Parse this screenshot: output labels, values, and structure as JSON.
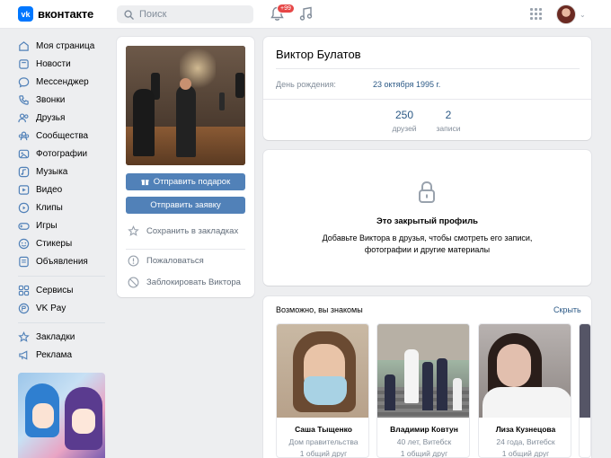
{
  "header": {
    "logo_letters": "vk",
    "logo_text": "вконтакте",
    "search_placeholder": "Поиск",
    "notifications_badge": "+99"
  },
  "sidebar": {
    "items": [
      {
        "label": "Моя страница",
        "icon": "home-icon"
      },
      {
        "label": "Новости",
        "icon": "news-icon"
      },
      {
        "label": "Мессенджер",
        "icon": "message-icon"
      },
      {
        "label": "Звонки",
        "icon": "phone-icon"
      },
      {
        "label": "Друзья",
        "icon": "users-icon"
      },
      {
        "label": "Сообщества",
        "icon": "communities-icon"
      },
      {
        "label": "Фотографии",
        "icon": "photo-icon"
      },
      {
        "label": "Музыка",
        "icon": "music-icon"
      },
      {
        "label": "Видео",
        "icon": "video-icon"
      },
      {
        "label": "Клипы",
        "icon": "clips-icon"
      },
      {
        "label": "Игры",
        "icon": "games-icon"
      },
      {
        "label": "Стикеры",
        "icon": "stickers-icon"
      },
      {
        "label": "Объявления",
        "icon": "ads-icon"
      }
    ],
    "items2": [
      {
        "label": "Сервисы",
        "icon": "services-icon"
      },
      {
        "label": "VK Pay",
        "icon": "vkpay-icon"
      }
    ],
    "items3": [
      {
        "label": "Закладки",
        "icon": "bookmark-icon"
      },
      {
        "label": "Реклама",
        "icon": "megaphone-icon"
      }
    ]
  },
  "profile": {
    "gift_button": "Отправить подарок",
    "friend_button": "Отправить заявку",
    "bookmark_label": "Сохранить в закладках",
    "report_label": "Пожаловаться",
    "block_label": "Заблокировать Виктора",
    "name": "Виктор Булатов",
    "birthday_label": "День рождения:",
    "birthday_value": "23 октября 1995 г.",
    "friends_count": "250",
    "friends_label": "друзей",
    "posts_count": "2",
    "posts_label": "записи"
  },
  "closed": {
    "title": "Это закрытый профиль",
    "text": "Добавьте Виктора в друзья, чтобы смотреть его записи, фотографии и другие материалы"
  },
  "suggestions": {
    "title": "Возможно, вы знакомы",
    "hide_label": "Скрыть",
    "people": [
      {
        "name": "Саша Тыщенко",
        "info": "Дом правительства",
        "mutual": "1 общий друг"
      },
      {
        "name": "Владимир Ковтун",
        "info": "40 лет, Витебск",
        "mutual": "1 общий друг"
      },
      {
        "name": "Лиза Кузнецова",
        "info": "24 года, Витебск",
        "mutual": "1 общий друг"
      }
    ]
  },
  "colors": {
    "brand": "#0077ff",
    "button": "#5181b8",
    "link": "#2a5885",
    "badge": "#e64646"
  }
}
